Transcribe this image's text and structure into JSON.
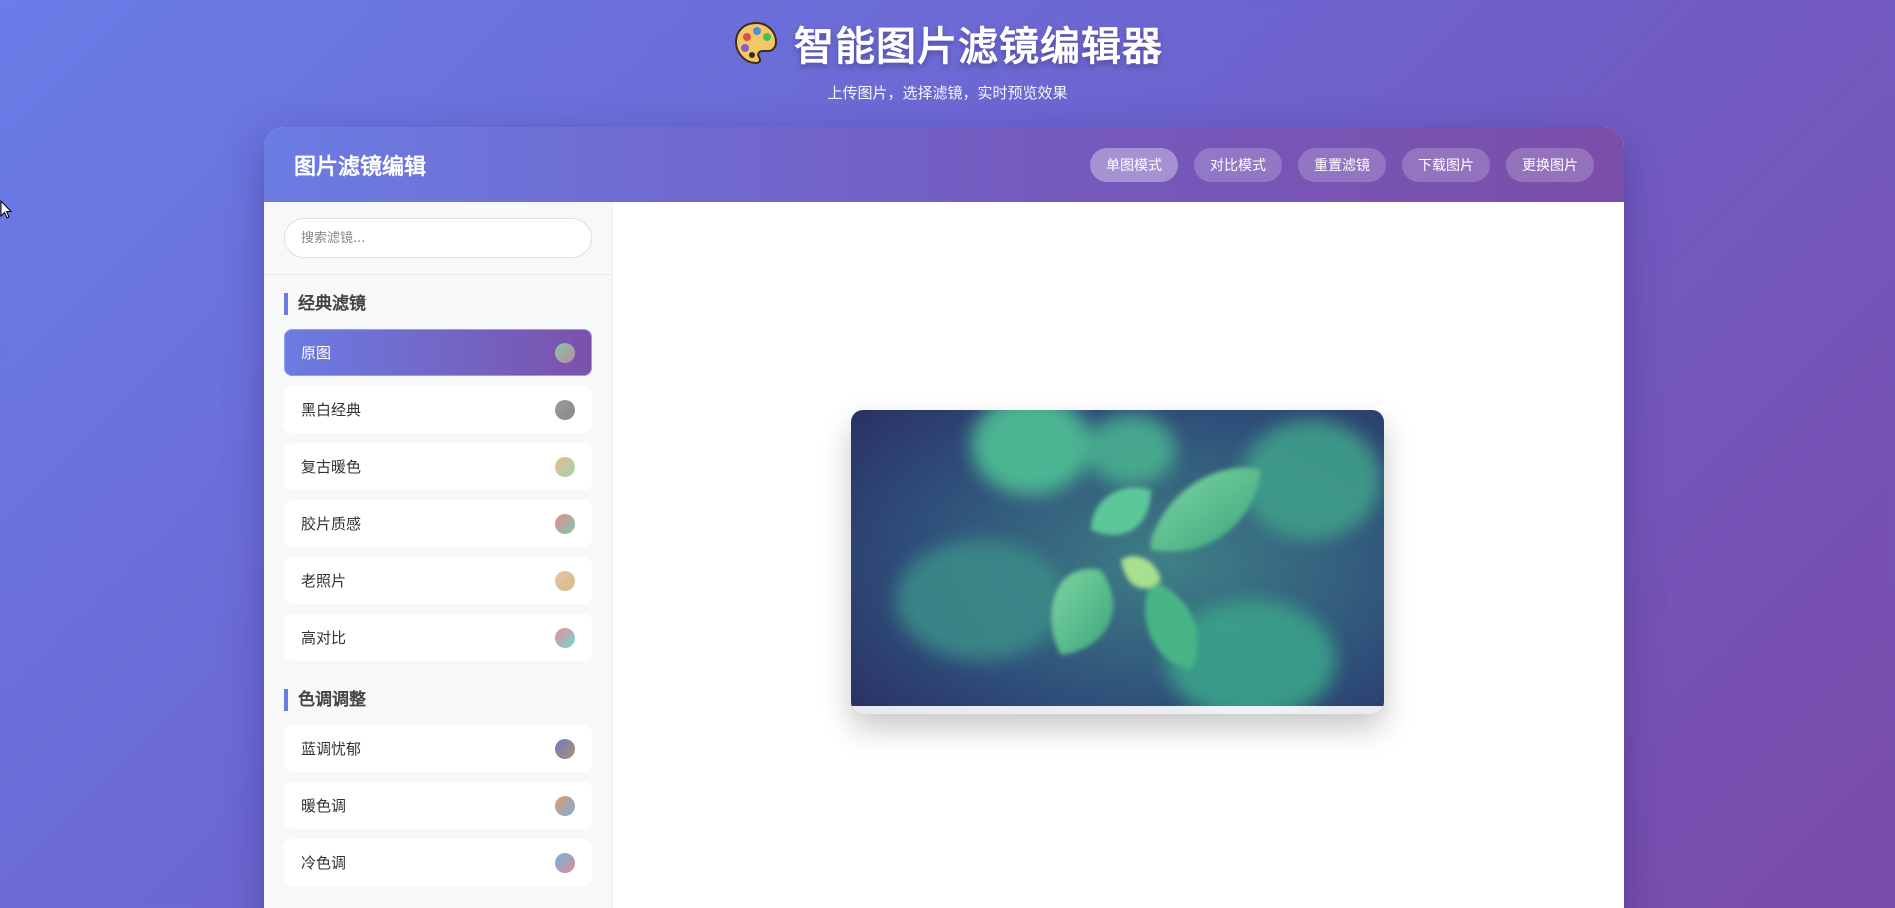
{
  "page": {
    "title": "智能图片滤镜编辑器",
    "subtitle": "上传图片，选择滤镜，实时预览效果",
    "title_icon": "palette-icon"
  },
  "editor": {
    "title": "图片滤镜编辑",
    "toolbar": [
      {
        "label": "单图模式",
        "active": true
      },
      {
        "label": "对比模式",
        "active": false
      },
      {
        "label": "重置滤镜",
        "active": false
      },
      {
        "label": "下载图片",
        "active": false
      },
      {
        "label": "更换图片",
        "active": false
      }
    ]
  },
  "sidebar": {
    "search": {
      "placeholder": "搜索滤镜...",
      "value": ""
    },
    "sections": [
      {
        "title": "经典滤镜",
        "items": [
          {
            "label": "原图",
            "active": true,
            "swatch": [
              "#7fc8a9",
              "#c08a9c"
            ]
          },
          {
            "label": "黑白经典",
            "active": false,
            "swatch": [
              "#9a9a9a",
              "#8a8a8a"
            ]
          },
          {
            "label": "复古暖色",
            "active": false,
            "swatch": [
              "#e9b98a",
              "#9fd5b0"
            ]
          },
          {
            "label": "胶片质感",
            "active": false,
            "swatch": [
              "#e98a8a",
              "#7fc8b0"
            ]
          },
          {
            "label": "老照片",
            "active": false,
            "swatch": [
              "#e5c89a",
              "#d4b890"
            ]
          },
          {
            "label": "高对比",
            "active": false,
            "swatch": [
              "#f08a9a",
              "#6fd9d0"
            ]
          }
        ]
      },
      {
        "title": "色调调整",
        "items": [
          {
            "label": "蓝调忧郁",
            "active": false,
            "swatch": [
              "#6a7ac8",
              "#b09070"
            ]
          },
          {
            "label": "暖色调",
            "active": false,
            "swatch": [
              "#e09a6a",
              "#7ab0e0"
            ]
          },
          {
            "label": "冷色调",
            "active": false,
            "swatch": [
              "#6ab8d8",
              "#e08a9a"
            ]
          }
        ]
      }
    ]
  },
  "colors": {
    "accent_start": "#6b7ce3",
    "accent_end": "#7a52ab"
  },
  "preview": {
    "subject": "mint-leaves-image"
  }
}
